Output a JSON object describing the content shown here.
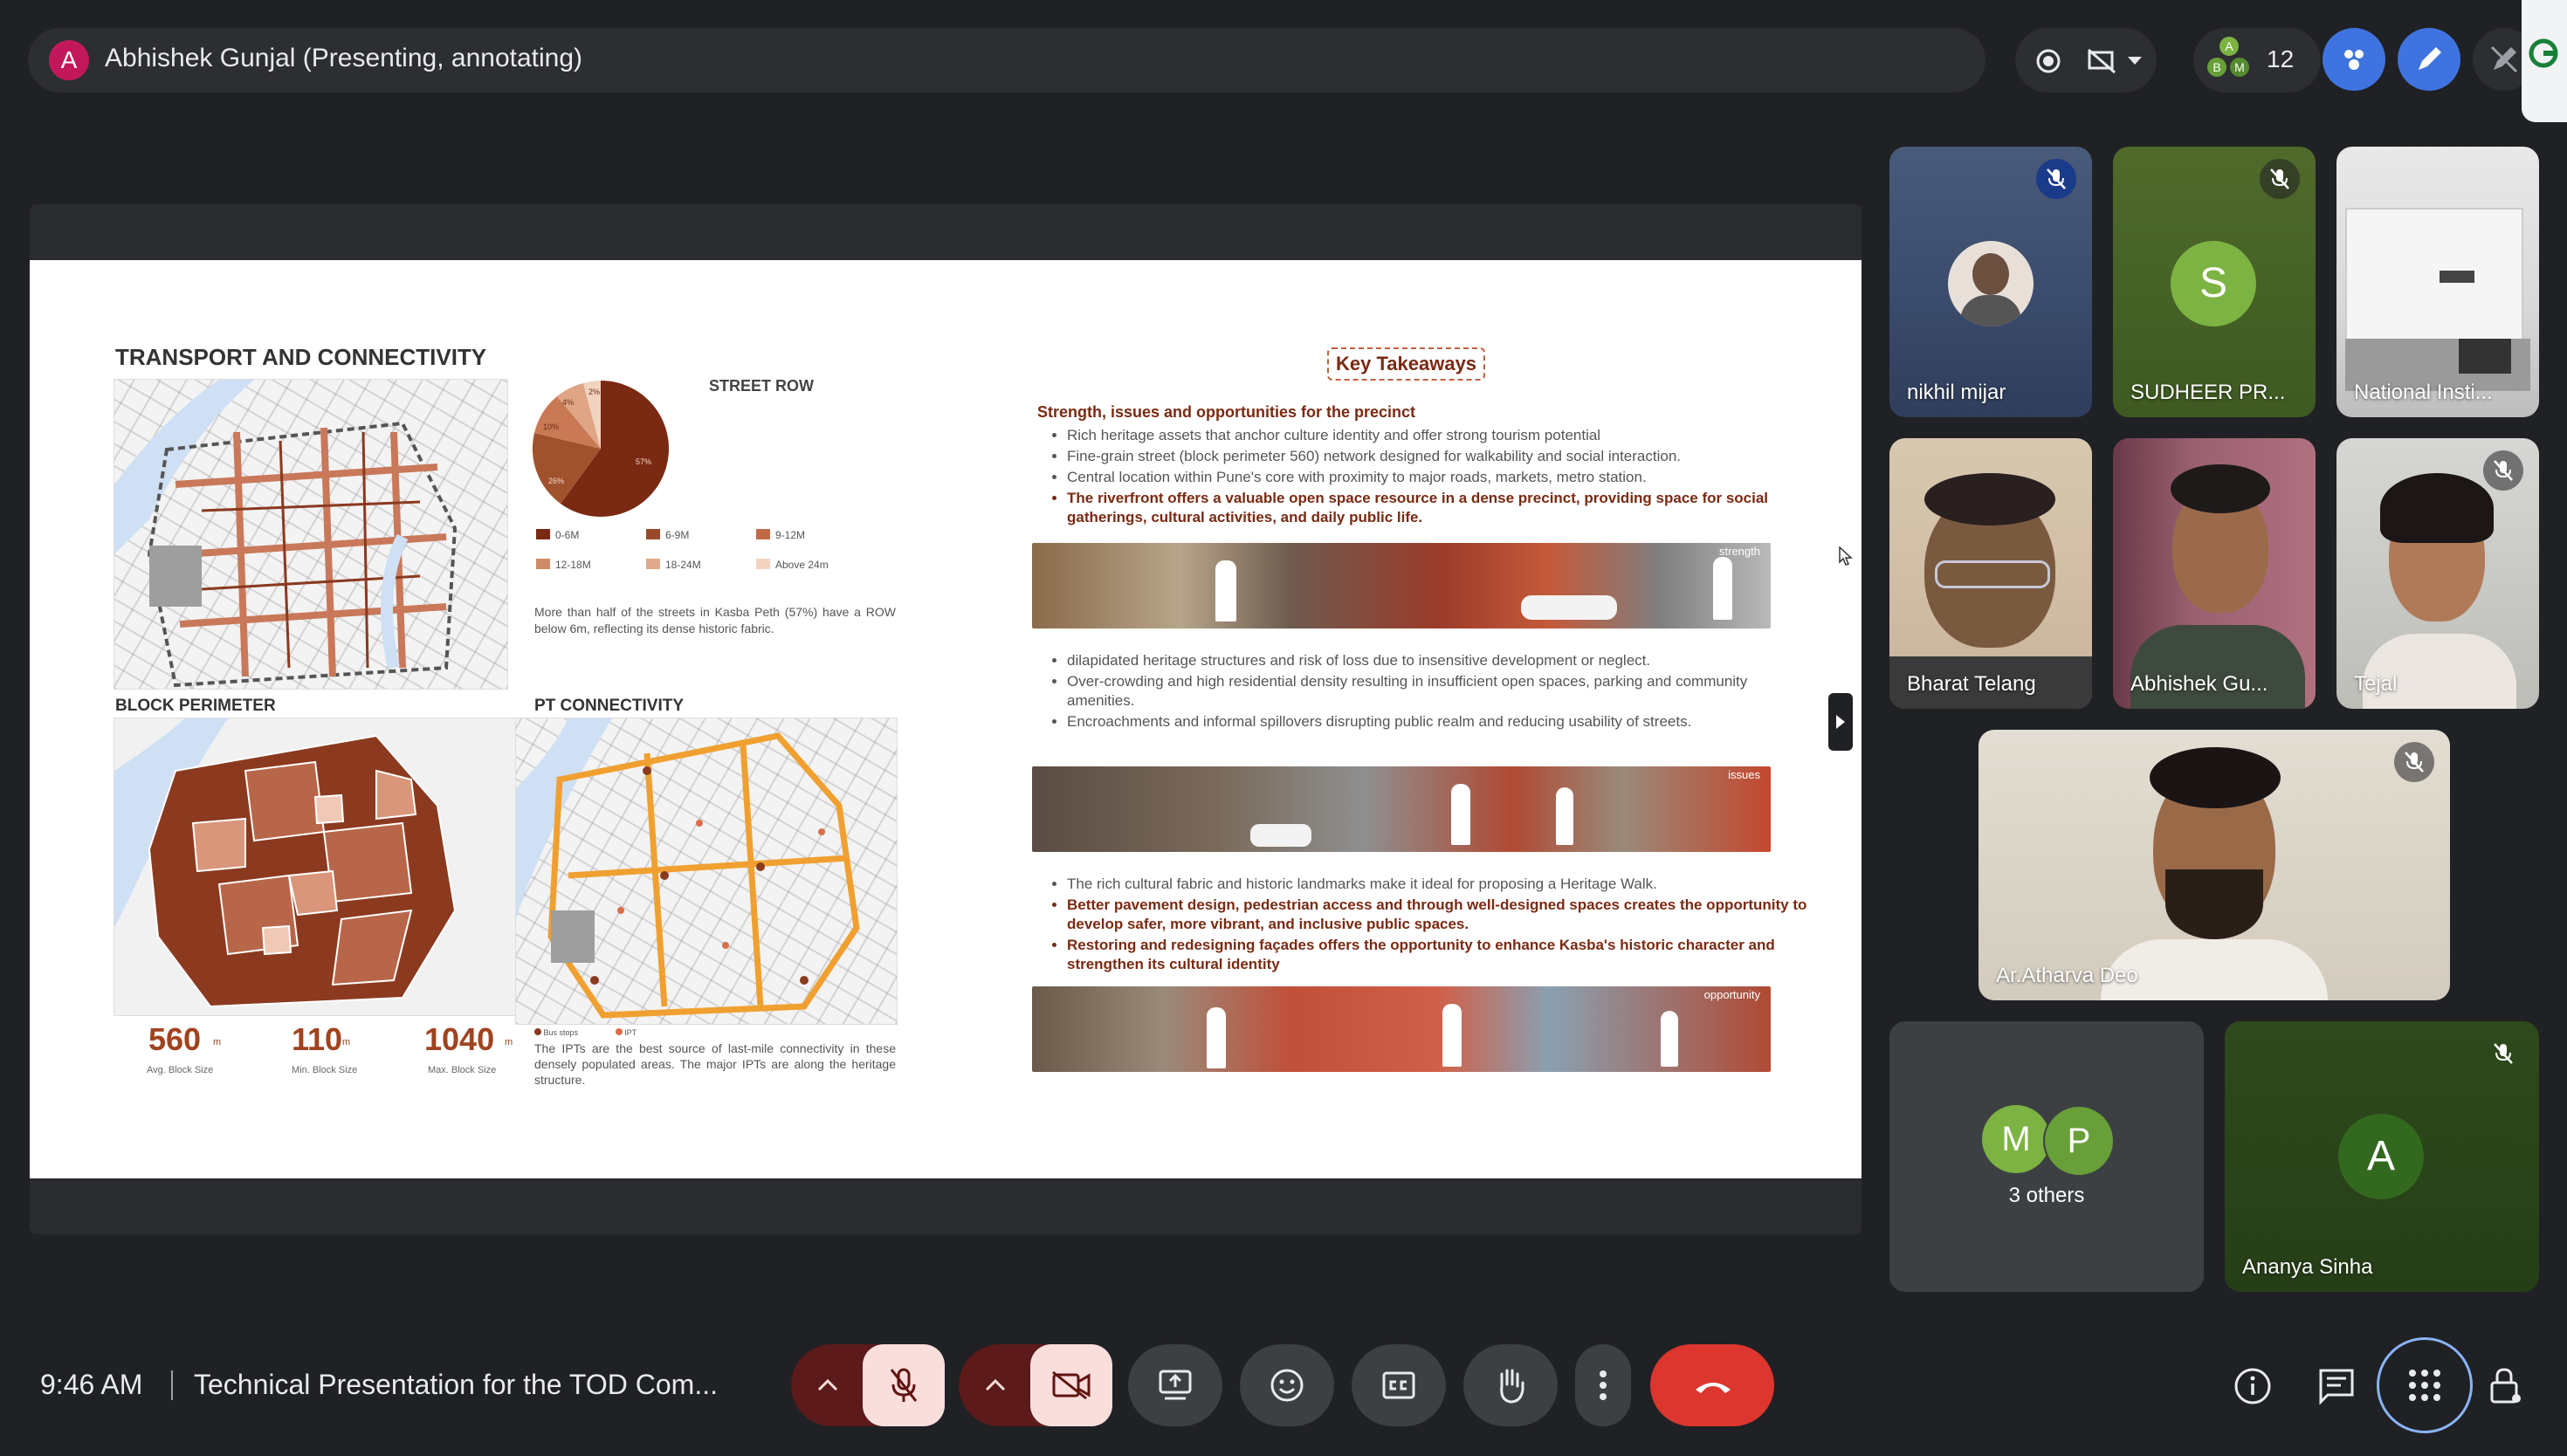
{
  "top": {
    "presenter_initial": "A",
    "presenter_label": "Abhishek Gunjal (Presenting, annotating)",
    "participant_count": "12",
    "participant_initials": [
      "A",
      "B",
      "M"
    ]
  },
  "slide": {
    "left_title": "TRANSPORT AND CONNECTIVITY",
    "street_row_title": "STREET ROW",
    "street_row_legend": [
      "0-6M",
      "6-9M",
      "9-12M",
      "12-18M",
      "18-24M",
      "Above 24m"
    ],
    "pie_labels": [
      "57%",
      "26%",
      "10%",
      "4%",
      "2%"
    ],
    "street_row_note": "More than half of the streets in Kasba Peth (57%) have a ROW below 6m, reflecting its dense historic fabric.",
    "block_perimeter_title": "BLOCK PERIMETER",
    "pt_connectivity_title": "PT CONNECTIVITY",
    "stats": [
      {
        "value": "560",
        "unit": "m",
        "caption": "Avg. Block Size"
      },
      {
        "value": "110",
        "unit": "m",
        "caption": "Min. Block Size"
      },
      {
        "value": "1040",
        "unit": "m",
        "caption": "Max. Block Size"
      }
    ],
    "pt_legend": [
      "Bus stops",
      "IPT"
    ],
    "pt_note": "The IPTs are the best source of last-mile connectivity in these densely populated areas. The major IPTs are along the heritage structure.",
    "key_takeaways": "Key Takeaways",
    "subheading": "Strength, issues and opportunities for the precinct",
    "strengths": [
      "Rich heritage assets that anchor culture identity and offer strong tourism potential",
      "Fine-grain street (block perimeter 560) network designed for walkability and social interaction.",
      "Central location within Pune's core with proximity to major roads, markets, metro station.",
      "The riverfront offers a valuable open space resource in a dense precinct, providing space for social gatherings, cultural activities, and daily public life."
    ],
    "strength_tag": "strength",
    "issues": [
      "dilapidated heritage structures and risk of loss due to insensitive development or neglect.",
      "Over-crowding and high residential density resulting in insufficient open spaces, parking and community amenities.",
      "Encroachments and informal spillovers disrupting public realm and reducing usability of streets."
    ],
    "issues_tag": "issues",
    "opportunities": [
      "The rich cultural fabric and historic landmarks make it ideal for proposing a Heritage Walk.",
      "Better pavement design, pedestrian access and through well-designed spaces creates the opportunity to develop safer, more vibrant, and inclusive public spaces.",
      "Restoring and redesigning façades offers the opportunity to enhance Kasba's historic character and strengthen its cultural identity"
    ],
    "opportunity_tag": "opportunity"
  },
  "participants": [
    {
      "name": "nikhil mijar"
    },
    {
      "name": "SUDHEER PR...",
      "initial": "S"
    },
    {
      "name": "National Insti..."
    },
    {
      "name": "Bharat Telang"
    },
    {
      "name": "Abhishek Gu..."
    },
    {
      "name": "Tejal"
    },
    {
      "name": "Ar.Atharva Deo"
    },
    {
      "name": "3 others",
      "initials": [
        "M",
        "P"
      ]
    },
    {
      "name": "Ananya Sinha",
      "initial": "A"
    }
  ],
  "bottom": {
    "time": "9:46 AM",
    "meeting_title": "Technical Presentation for the TOD Com..."
  },
  "colors": {
    "background": "#202124",
    "end_call": "#dc362e",
    "muted_red": "#f9dedc",
    "accent_blue": "#8ab4f8",
    "slide_maroon": "#7a2a12"
  }
}
